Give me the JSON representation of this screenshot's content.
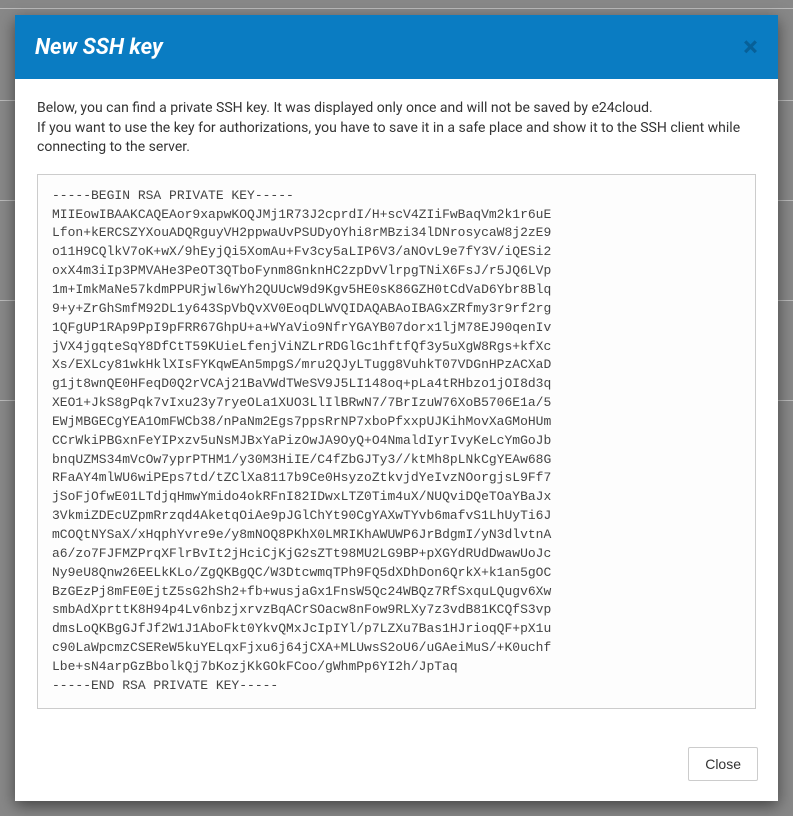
{
  "modal": {
    "title": "New SSH key",
    "close_x": "×",
    "intro_line1": "Below, you can find a private SSH key. It was displayed only once and will not be saved by e24cloud.",
    "intro_line2": "If you want to use the key for authorizations, you have to save it in a safe place and show it to the SSH client while connecting to the server.",
    "key_text": "-----BEGIN RSA PRIVATE KEY-----\nMIIEowIBAAKCAQEAor9xapwKOQJMj1R73J2cprdI/H+scV4ZIiFwBaqVm2k1r6uE\nLfon+kERCSZYXouADQRguyVH2ppwaUvPSUDyOYhi8rMBzi34lDNrosycaW8j2zE9\no11H9CQlkV7oK+wX/9hEyjQi5XomAu+Fv3cy5aLIP6V3/aNOvL9e7fY3V/iQESi2\noxX4m3iIp3PMVAHe3PeOT3QTboFynm8GnknHC2zpDvVlrpgTNiX6FsJ/r5JQ6LVp\n1m+ImkMaNe57kdmPPURjwl6wYh2QUUcW9d9Kgv5HE0sK86GZH0tCdVaD6Ybr8Blq\n9+y+ZrGhSmfM92DL1y643SpVbQvXV0EoqDLWVQIDAQABAoIBAGxZRfmy3r9rf2rg\n1QFgUP1RAp9PpI9pFRR67GhpU+a+WYaVio9NfrYGAYB07dorx1ljM78EJ90qenIv\njVX4jgqteSqY8DfCtT59KUieLfenjViNZLrRDGlGc1hftfQf3y5uXgW8Rgs+kfXc\nXs/EXLcy81wkHklXIsFYKqwEAn5mpgS/mru2QJyLTugg8VuhkT07VDGnHPzACXaD\ng1jt8wnQE0HFeqD0Q2rVCAj21BaVWdTWeSV9J5LI148oq+pLa4tRHbzo1jOI8d3q\nXEO1+JkS8gPqk7vIxu23y7ryeOLa1XUO3LlIlBRwN7/7BrIzuW76XoB5706E1a/5\nEWjMBGECgYEA1OmFWCb38/nPaNm2Egs7ppsRrNP7xboPfxxpUJKihMovXaGMoHUm\nCCrWkiPBGxnFeYIPxzv5uNsMJBxYaPizOwJA9OyQ+O4NmaldIyrIvyKeLcYmGoJb\nbnqUZMS34mVcOw7yprPTHM1/y30M3HiIE/C4fZbGJTy3//ktMh8pLNkCgYEAw68G\nRFaAY4mlWU6wiPEps7td/tZClXa8117b9Ce0HsyzoZtkvjdYeIvzNOorgjsL9Ff7\njSoFjOfwE01LTdjqHmwYmido4okRFnI82IDwxLTZ0Tim4uX/NUQviDQeTOaYBaJx\n3VkmiZDEcUZpmRrzqd4AketqOiAe9pJGlChYt90CgYAXwTYvb6mafvS1LhUyTi6J\nmCOQtNYSaX/xHqphYvre9e/y8mNOQ8PKhX0LMRIKhAWUWP6JrBdgmI/yN3dlvtnA\na6/zo7FJFMZPrqXFlrBvIt2jHciCjKjG2sZTt98MU2LG9BP+pXGYdRUdDwawUoJc\nNy9eU8Qnw26EELkKLo/ZgQKBgQC/W3DtcwmqTPh9FQ5dXDhDon6QrkX+k1an5gOC\nBzGEzPj8mFE0EjtZ5sG2hSh2+fb+wusjaGx1FnsW5Qc24WBQz7RfSxquLQugv6Xw\nsmbAdXprttK8H94p4Lv6nbzjxrvzBqACrSOacw8nFow9RLXy7z3vdB81KCQfS3vp\ndmsLoQKBgGJfJf2W1J1AboFkt0YkvQMxJcIpIYl/p7LZXu7Bas1HJrioqQF+pX1u\nc90LaWpcmzCSEReW5kuYELqxFjxu6j64jCXA+MLUwsS2oU6/uGAeiMuS/+K0uchf\nLbe+sN4arpGzBbolkQj7bKozjKkGOkFCoo/gWhmPp6YI2h/JpTaq\n-----END RSA PRIVATE KEY-----",
    "close_button_label": "Close"
  },
  "colors": {
    "header_bg": "#0a7cc2",
    "close_x": "#075e94",
    "border": "#ccc"
  }
}
